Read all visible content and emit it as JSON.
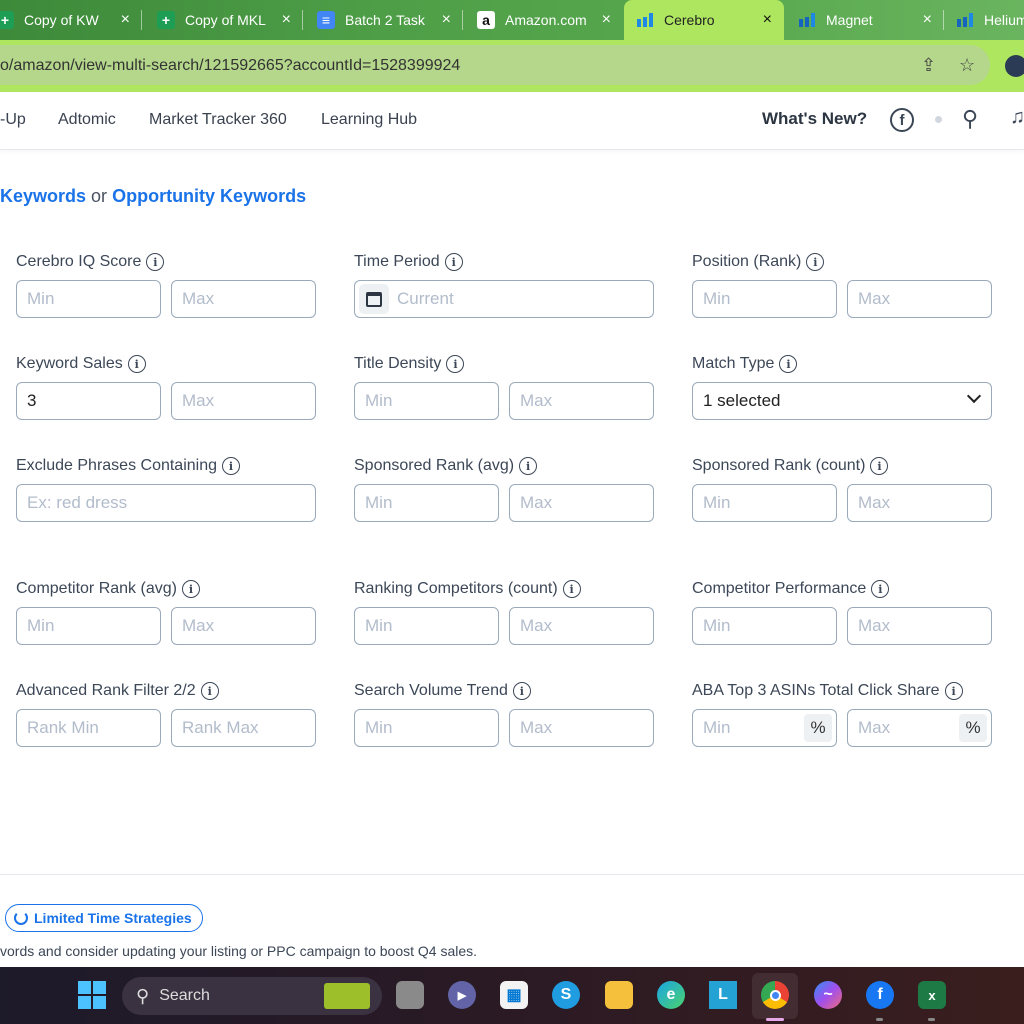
{
  "browser": {
    "tabs": [
      {
        "label": "Copy of KW",
        "icon": "google-sheets-icon",
        "active": false
      },
      {
        "label": "Copy of MKL",
        "icon": "google-sheets-icon",
        "active": false
      },
      {
        "label": "Batch 2 Task",
        "icon": "google-docs-icon",
        "active": false
      },
      {
        "label": "Amazon.com",
        "icon": "amazon-icon",
        "active": false
      },
      {
        "label": "Cerebro",
        "icon": "helium10-icon",
        "active": true
      },
      {
        "label": "Magnet",
        "icon": "helium10-icon",
        "active": false
      },
      {
        "label": "Helium",
        "icon": "helium10-icon",
        "active": false
      }
    ],
    "close_glyph": "×",
    "url": "o/amazon/view-multi-search/121592665?accountId=1528399924",
    "share_icon": "share-icon",
    "bookmark_icon": "star-icon"
  },
  "navbar": {
    "links": [
      "-Up",
      "Adtomic",
      "Market Tracker 360",
      "Learning Hub"
    ],
    "whats_new": "What's New?",
    "facebook_glyph": "f",
    "ai_search_glyph": "⚲",
    "bell_glyph": "🔔"
  },
  "heading": {
    "link1": "Keywords",
    "or": "or",
    "link2": "Opportunity Keywords"
  },
  "info_glyph": "i",
  "filters": [
    {
      "label": "Cerebro IQ Score",
      "type": "range",
      "min": {
        "value": "",
        "placeholder": "Min"
      },
      "max": {
        "value": "",
        "placeholder": "Max"
      }
    },
    {
      "label": "Time Period",
      "type": "date",
      "value": "",
      "placeholder": "Current"
    },
    {
      "label": "Position (Rank)",
      "type": "range",
      "min": {
        "value": "",
        "placeholder": "Min"
      },
      "max": {
        "value": "",
        "placeholder": "Max"
      }
    },
    {
      "label": "Keyword Sales",
      "type": "range",
      "min": {
        "value": "3",
        "placeholder": "Min"
      },
      "max": {
        "value": "",
        "placeholder": "Max"
      }
    },
    {
      "label": "Title Density",
      "type": "range",
      "min": {
        "value": "",
        "placeholder": "Min"
      },
      "max": {
        "value": "",
        "placeholder": "Max"
      }
    },
    {
      "label": "Match Type",
      "type": "select",
      "value": "1 selected"
    },
    {
      "label": "Exclude Phrases Containing",
      "type": "text",
      "value": "",
      "placeholder": "Ex: red dress"
    },
    {
      "label": "Sponsored Rank (avg)",
      "type": "range",
      "min": {
        "value": "",
        "placeholder": "Min"
      },
      "max": {
        "value": "",
        "placeholder": "Max"
      }
    },
    {
      "label": "Sponsored Rank (count)",
      "type": "range",
      "min": {
        "value": "",
        "placeholder": "Min"
      },
      "max": {
        "value": "",
        "placeholder": "Max"
      }
    },
    {
      "label": "Competitor Rank (avg)",
      "type": "range",
      "min": {
        "value": "",
        "placeholder": "Min"
      },
      "max": {
        "value": "",
        "placeholder": "Max"
      }
    },
    {
      "label": "Ranking Competitors (count)",
      "type": "range",
      "min": {
        "value": "",
        "placeholder": "Min"
      },
      "max": {
        "value": "",
        "placeholder": "Max"
      }
    },
    {
      "label": "Competitor Performance",
      "type": "range",
      "min": {
        "value": "",
        "placeholder": "Min"
      },
      "max": {
        "value": "",
        "placeholder": "Max"
      }
    },
    {
      "label": "Advanced Rank Filter 2/2",
      "type": "range",
      "min": {
        "value": "",
        "placeholder": "Rank Min"
      },
      "max": {
        "value": "",
        "placeholder": "Rank Max"
      }
    },
    {
      "label": "Search Volume Trend",
      "type": "range",
      "min": {
        "value": "",
        "placeholder": "Min"
      },
      "max": {
        "value": "",
        "placeholder": "Max"
      }
    },
    {
      "label": "ABA Top 3 ASINs Total Click Share",
      "type": "percent-range",
      "unit": "%",
      "min": {
        "value": "",
        "placeholder": "Min"
      },
      "max": {
        "value": "",
        "placeholder": "Max"
      }
    }
  ],
  "footer": {
    "button_label": "Limited Time Strategies",
    "tip": "vords and consider updating your listing or PPC campaign to boost Q4 sales."
  },
  "taskbar": {
    "search_label": "Search",
    "apps": [
      {
        "name": "task-view",
        "glyph": ""
      },
      {
        "name": "teams-meet",
        "glyph": "▶"
      },
      {
        "name": "microsoft-store",
        "glyph": "▦"
      },
      {
        "name": "skype",
        "glyph": "S"
      },
      {
        "name": "file-explorer",
        "glyph": ""
      },
      {
        "name": "edge",
        "glyph": "e"
      },
      {
        "name": "lingvanex",
        "glyph": "L"
      },
      {
        "name": "chrome",
        "glyph": ""
      },
      {
        "name": "messenger",
        "glyph": "~"
      },
      {
        "name": "facebook",
        "glyph": "f"
      },
      {
        "name": "excel",
        "glyph": "x"
      }
    ]
  },
  "colors": {
    "accent": "#1a73e8",
    "active_tab": "#aee660",
    "input_border": "#9aaabb",
    "placeholder": "#b2bccb"
  }
}
